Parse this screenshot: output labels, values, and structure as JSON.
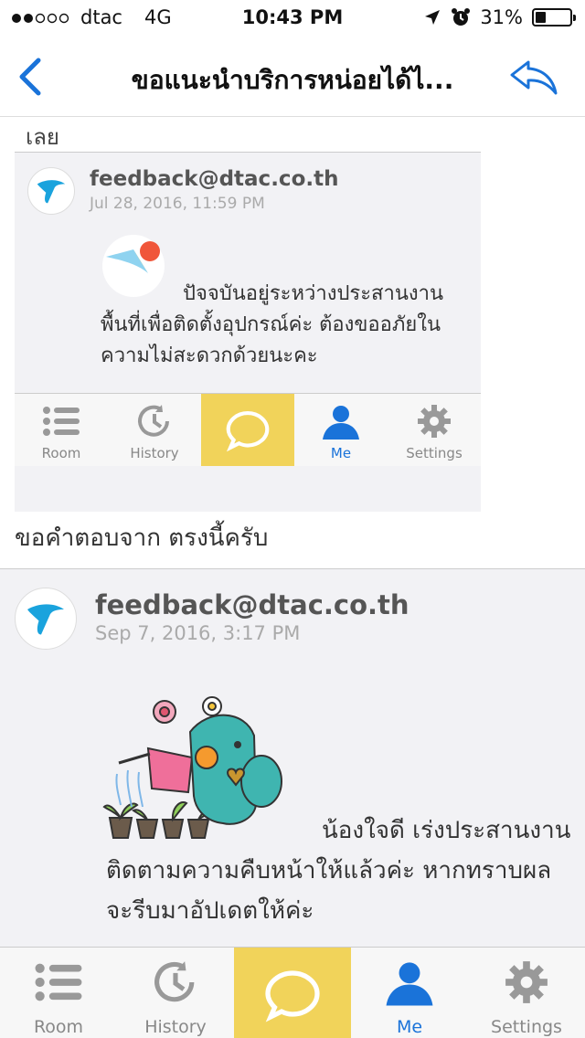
{
  "status_bar": {
    "carrier": "dtac",
    "network": "4G",
    "time": "10:43 PM",
    "battery": "31%",
    "battery_level": 0.31
  },
  "nav": {
    "title": "ขอแนะนำบริการหน่อยได้ไ...",
    "back_icon": "chevron-left-icon",
    "reply_icon": "reply-arrow-icon"
  },
  "thread": {
    "fragment_text": "เลย",
    "embedded_message": {
      "sender": "feedback@dtac.co.th",
      "date": "Jul 28, 2016, 11:59 PM",
      "body": "ปัจจบันอยู่ระหว่างประสานงานพื้นที่เพื่อติดตั้งอุปกรณ์ค่ะ  ต้องขออภัยในความไม่สะดวกด้วยนะคะ"
    },
    "embedded_tabs": [
      {
        "label": "Room",
        "icon": "list-icon"
      },
      {
        "label": "History",
        "icon": "history-clock-icon"
      },
      {
        "label": "",
        "icon": "chat-bubble-icon"
      },
      {
        "label": "Me",
        "icon": "person-icon"
      },
      {
        "label": "Settings",
        "icon": "gear-icon"
      }
    ],
    "reply_text": "ขอคำตอบจาก ตรงนี้ครับ",
    "message": {
      "sender": "feedback@dtac.co.th",
      "date": "Sep 7, 2016, 3:17 PM",
      "body": "น้องใจดี เร่งประสานงานติดตามความคืบหน้าให้แล้วค่ะ หากทราบผลจะรีบมาอัปเดตให้ค่ะ"
    }
  },
  "tab_bar": [
    {
      "label": "Room",
      "icon": "list-icon"
    },
    {
      "label": "History",
      "icon": "history-clock-icon"
    },
    {
      "label": "",
      "icon": "chat-bubble-icon"
    },
    {
      "label": "Me",
      "icon": "person-icon"
    },
    {
      "label": "Settings",
      "icon": "gear-icon"
    }
  ],
  "colors": {
    "accent_blue": "#1a73d9",
    "active_tab": "#f1d35a",
    "dtac_blue": "#1aa3dd"
  }
}
